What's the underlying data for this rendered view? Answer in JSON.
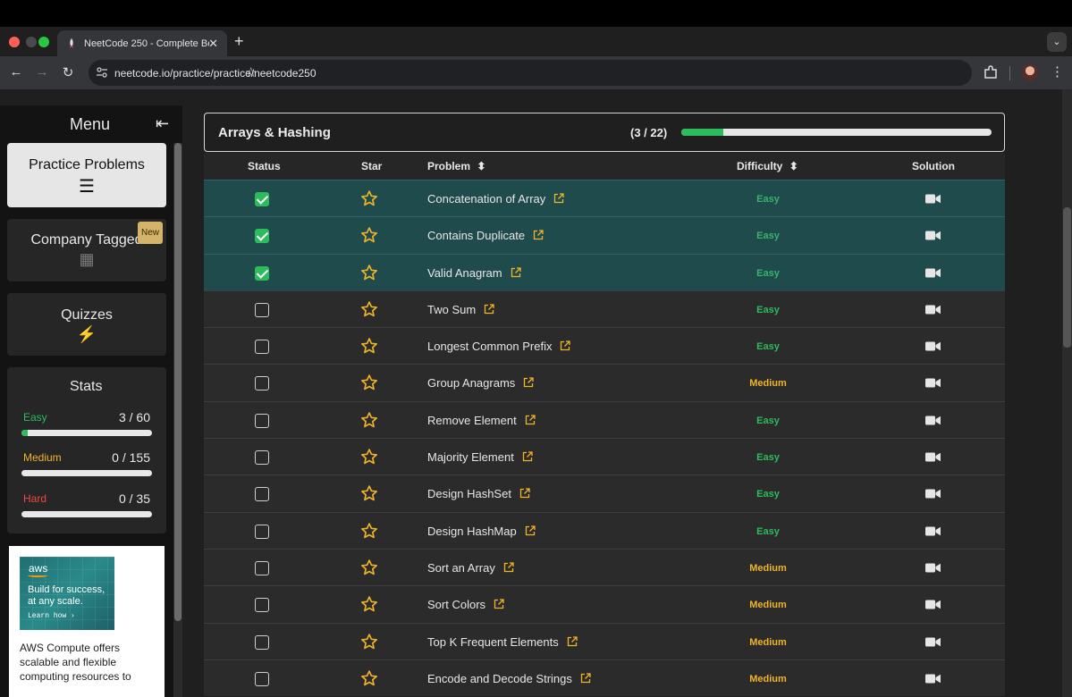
{
  "browser": {
    "tab_title": "NeetCode 250 - Complete Be",
    "tab_close": "✕",
    "new_tab": "+",
    "tab_menu": "⌄",
    "url": "neetcode.io/practice/practice/neetcode250",
    "back": "←",
    "forward": "→",
    "reload": "↻",
    "bookmark": "☆",
    "more": "⋮"
  },
  "sidebar": {
    "title": "Menu",
    "back_arrow": "⇤",
    "cards": [
      {
        "label": "Practice Problems",
        "icon": "list-icon",
        "glyph": "☰"
      },
      {
        "label": "Company Tagged",
        "icon": "building-icon",
        "glyph": "▦",
        "badge": "New"
      },
      {
        "label": "Quizzes",
        "icon": "bolt-icon",
        "glyph": "⚡"
      }
    ],
    "stats": {
      "title": "Stats",
      "items": [
        {
          "label": "Easy",
          "value": "3 / 60",
          "fraction": 0.05,
          "color": "#2cbb5d"
        },
        {
          "label": "Medium",
          "value": "0 / 155",
          "fraction": 0,
          "color": "#f0b428"
        },
        {
          "label": "Hard",
          "value": "0 / 35",
          "fraction": 0,
          "color": "#ef4743"
        }
      ]
    },
    "ad": {
      "logo": "aws",
      "headline": "Build for success, at any scale.",
      "cta": "Learn how ›",
      "body": "AWS Compute offers scalable and flexible computing resources to"
    }
  },
  "section": {
    "title": "Arrays & Hashing",
    "count": "(3 / 22)",
    "progress": 0.136
  },
  "table": {
    "headers": {
      "status": "Status",
      "star": "Star",
      "problem": "Problem",
      "difficulty": "Difficulty",
      "solution": "Solution",
      "sort_glyph": "⬍"
    },
    "rows": [
      {
        "name": "Concatenation of Array",
        "difficulty": "Easy",
        "done": true
      },
      {
        "name": "Contains Duplicate",
        "difficulty": "Easy",
        "done": true
      },
      {
        "name": "Valid Anagram",
        "difficulty": "Easy",
        "done": true
      },
      {
        "name": "Two Sum",
        "difficulty": "Easy",
        "done": false
      },
      {
        "name": "Longest Common Prefix",
        "difficulty": "Easy",
        "done": false
      },
      {
        "name": "Group Anagrams",
        "difficulty": "Medium",
        "done": false
      },
      {
        "name": "Remove Element",
        "difficulty": "Easy",
        "done": false
      },
      {
        "name": "Majority Element",
        "difficulty": "Easy",
        "done": false
      },
      {
        "name": "Design HashSet",
        "difficulty": "Easy",
        "done": false
      },
      {
        "name": "Design HashMap",
        "difficulty": "Easy",
        "done": false
      },
      {
        "name": "Sort an Array",
        "difficulty": "Medium",
        "done": false
      },
      {
        "name": "Sort Colors",
        "difficulty": "Medium",
        "done": false
      },
      {
        "name": "Top K Frequent Elements",
        "difficulty": "Medium",
        "done": false
      },
      {
        "name": "Encode and Decode Strings",
        "difficulty": "Medium",
        "done": false
      }
    ]
  },
  "colors": {
    "accent_green": "#2cbb5d",
    "star_gold": "#f0b428",
    "done_row": "#1f4b4d"
  }
}
